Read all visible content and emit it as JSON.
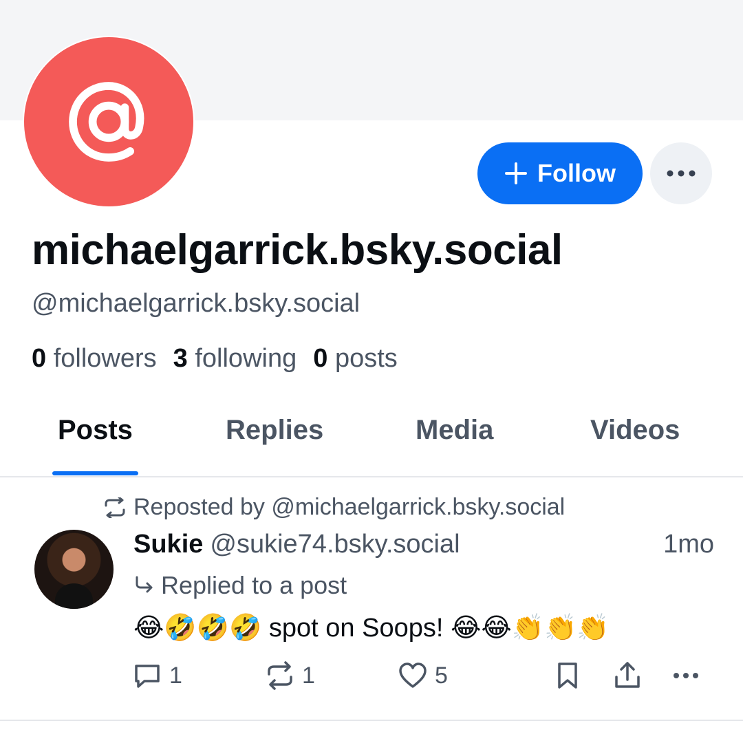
{
  "profile": {
    "display_name": "michaelgarrick.bsky.social",
    "handle": "@michaelgarrick.bsky.social",
    "follow_label": "Follow",
    "stats": {
      "followers_count": "0",
      "followers_label": "followers",
      "following_count": "3",
      "following_label": "following",
      "posts_count": "0",
      "posts_label": "posts"
    }
  },
  "tabs": [
    {
      "label": "Posts",
      "active": true
    },
    {
      "label": "Replies",
      "active": false
    },
    {
      "label": "Media",
      "active": false
    },
    {
      "label": "Videos",
      "active": false
    }
  ],
  "post": {
    "repost_text": "Reposted by @michaelgarrick.bsky.social",
    "author": "Sukie",
    "author_handle": "@sukie74.bsky.social",
    "time": "1mo",
    "reply_text": "Replied to a post",
    "text": "😂🤣🤣🤣 spot on Soops! 😂😂👏👏👏",
    "actions": {
      "replies": "1",
      "reposts": "1",
      "likes": "5"
    }
  },
  "colors": {
    "accent": "#0a6ff4",
    "avatar_bg": "#f45a58",
    "muted_text": "#4b5563"
  }
}
